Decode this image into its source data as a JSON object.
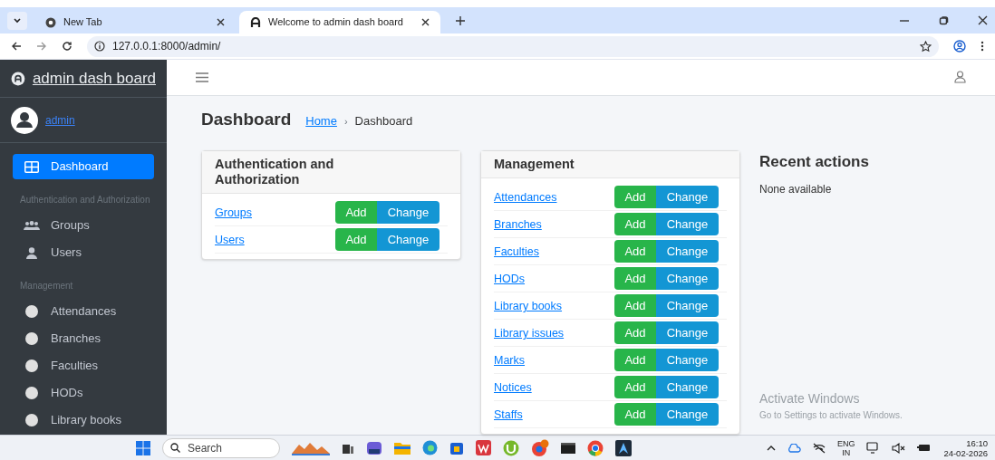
{
  "browser": {
    "tabs": [
      {
        "title": "New Tab",
        "selected": false
      },
      {
        "title": "Welcome to admin dash board",
        "selected": true
      }
    ],
    "url": "127.0.0.1:8000/admin/"
  },
  "sidebar": {
    "brand": "admin dash board",
    "user": "admin",
    "items": [
      {
        "kind": "link",
        "label": "Dashboard",
        "selected": true
      },
      {
        "kind": "header",
        "label": "Authentication and Authorization"
      },
      {
        "kind": "link",
        "label": "Groups",
        "selected": false
      },
      {
        "kind": "link",
        "label": "Users",
        "selected": false
      },
      {
        "kind": "header",
        "label": "Management"
      },
      {
        "kind": "link",
        "label": "Attendances",
        "selected": false
      },
      {
        "kind": "link",
        "label": "Branches",
        "selected": false
      },
      {
        "kind": "link",
        "label": "Faculties",
        "selected": false
      },
      {
        "kind": "link",
        "label": "HODs",
        "selected": false
      },
      {
        "kind": "link",
        "label": "Library books",
        "selected": false
      }
    ]
  },
  "page": {
    "title": "Dashboard",
    "breadcrumb": [
      {
        "kind": "link",
        "label": "Home"
      },
      {
        "kind": "sep",
        "label": "›"
      },
      {
        "kind": "text",
        "label": "Dashboard"
      }
    ]
  },
  "apps": [
    {
      "title": "Authentication and Authorization",
      "models": [
        {
          "name": "Groups",
          "add": "Add",
          "change": "Change"
        },
        {
          "name": "Users",
          "add": "Add",
          "change": "Change"
        }
      ]
    },
    {
      "title": "Management",
      "models": [
        {
          "name": "Attendances",
          "add": "Add",
          "change": "Change"
        },
        {
          "name": "Branches",
          "add": "Add",
          "change": "Change"
        },
        {
          "name": "Faculties",
          "add": "Add",
          "change": "Change"
        },
        {
          "name": "HODs",
          "add": "Add",
          "change": "Change"
        },
        {
          "name": "Library books",
          "add": "Add",
          "change": "Change"
        },
        {
          "name": "Library issues",
          "add": "Add",
          "change": "Change"
        },
        {
          "name": "Marks",
          "add": "Add",
          "change": "Change"
        },
        {
          "name": "Notices",
          "add": "Add",
          "change": "Change"
        },
        {
          "name": "Staffs",
          "add": "Add",
          "change": "Change"
        }
      ]
    }
  ],
  "recent": {
    "title": "Recent actions",
    "empty": "None available"
  },
  "activation": {
    "title": "Activate Windows",
    "subtitle": "Go to Settings to activate Windows."
  },
  "taskbar": {
    "search": "Search",
    "lang": "ENG",
    "region": "IN",
    "time": "16:10",
    "date": "24-02-2026"
  }
}
